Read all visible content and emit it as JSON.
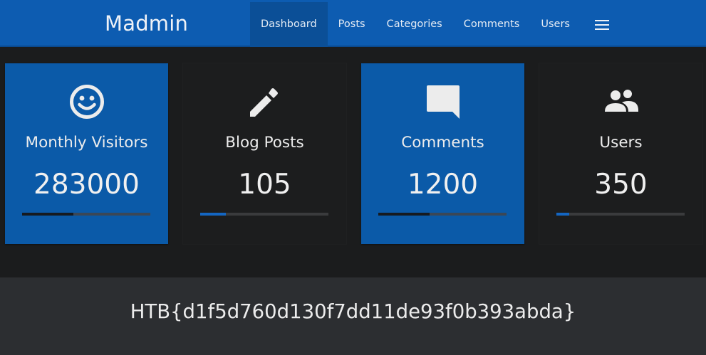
{
  "app": {
    "brand": "Madmin"
  },
  "nav": {
    "items": [
      {
        "label": "Dashboard",
        "active": true
      },
      {
        "label": "Posts",
        "active": false
      },
      {
        "label": "Categories",
        "active": false
      },
      {
        "label": "Comments",
        "active": false
      },
      {
        "label": "Users",
        "active": false
      }
    ],
    "menu_icon": "hamburger-menu-icon"
  },
  "cards": [
    {
      "icon": "smiley-face-icon",
      "label": "Monthly Visitors",
      "value": "283000",
      "progress": 0.4,
      "theme": "blue"
    },
    {
      "icon": "pencil-icon",
      "label": "Blog Posts",
      "value": "105",
      "progress": 0.2,
      "theme": "dark"
    },
    {
      "icon": "comment-bubble-icon",
      "label": "Comments",
      "value": "1200",
      "progress": 0.4,
      "theme": "blue"
    },
    {
      "icon": "users-icon",
      "label": "Users",
      "value": "350",
      "progress": 0.1,
      "theme": "dark"
    }
  ],
  "footer": {
    "flag": "HTB{d1f5d760d130f7dd11de93f0b393abda}"
  },
  "colors": {
    "navbar": "#0d5cb1",
    "card_blue": "#0b5aa8",
    "card_dark": "#1c1d1e",
    "background": "#1b1c1d",
    "footer": "#2c2e31"
  }
}
